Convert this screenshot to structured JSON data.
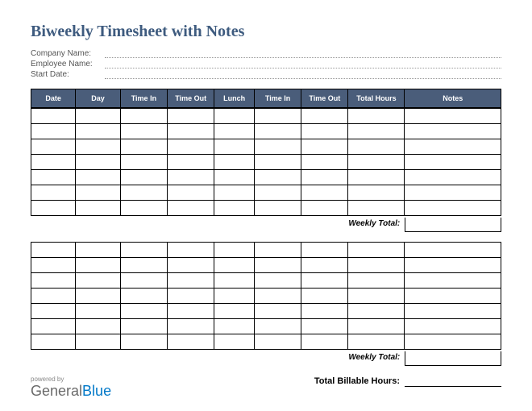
{
  "title": "Biweekly Timesheet with Notes",
  "fields": {
    "company": "Company Name:",
    "employee": "Employee Name:",
    "startdate": "Start Date:"
  },
  "columns": {
    "date": "Date",
    "day": "Day",
    "timein": "Time In",
    "timeout": "Time Out",
    "lunch": "Lunch",
    "timein2": "Time In",
    "timeout2": "Time Out",
    "total": "Total Hours",
    "notes": "Notes"
  },
  "weekly_total_label": "Weekly Total:",
  "billable_label": "Total Billable Hours:",
  "brand": {
    "powered": "powered by",
    "part1": "General",
    "part2": "Blue"
  }
}
